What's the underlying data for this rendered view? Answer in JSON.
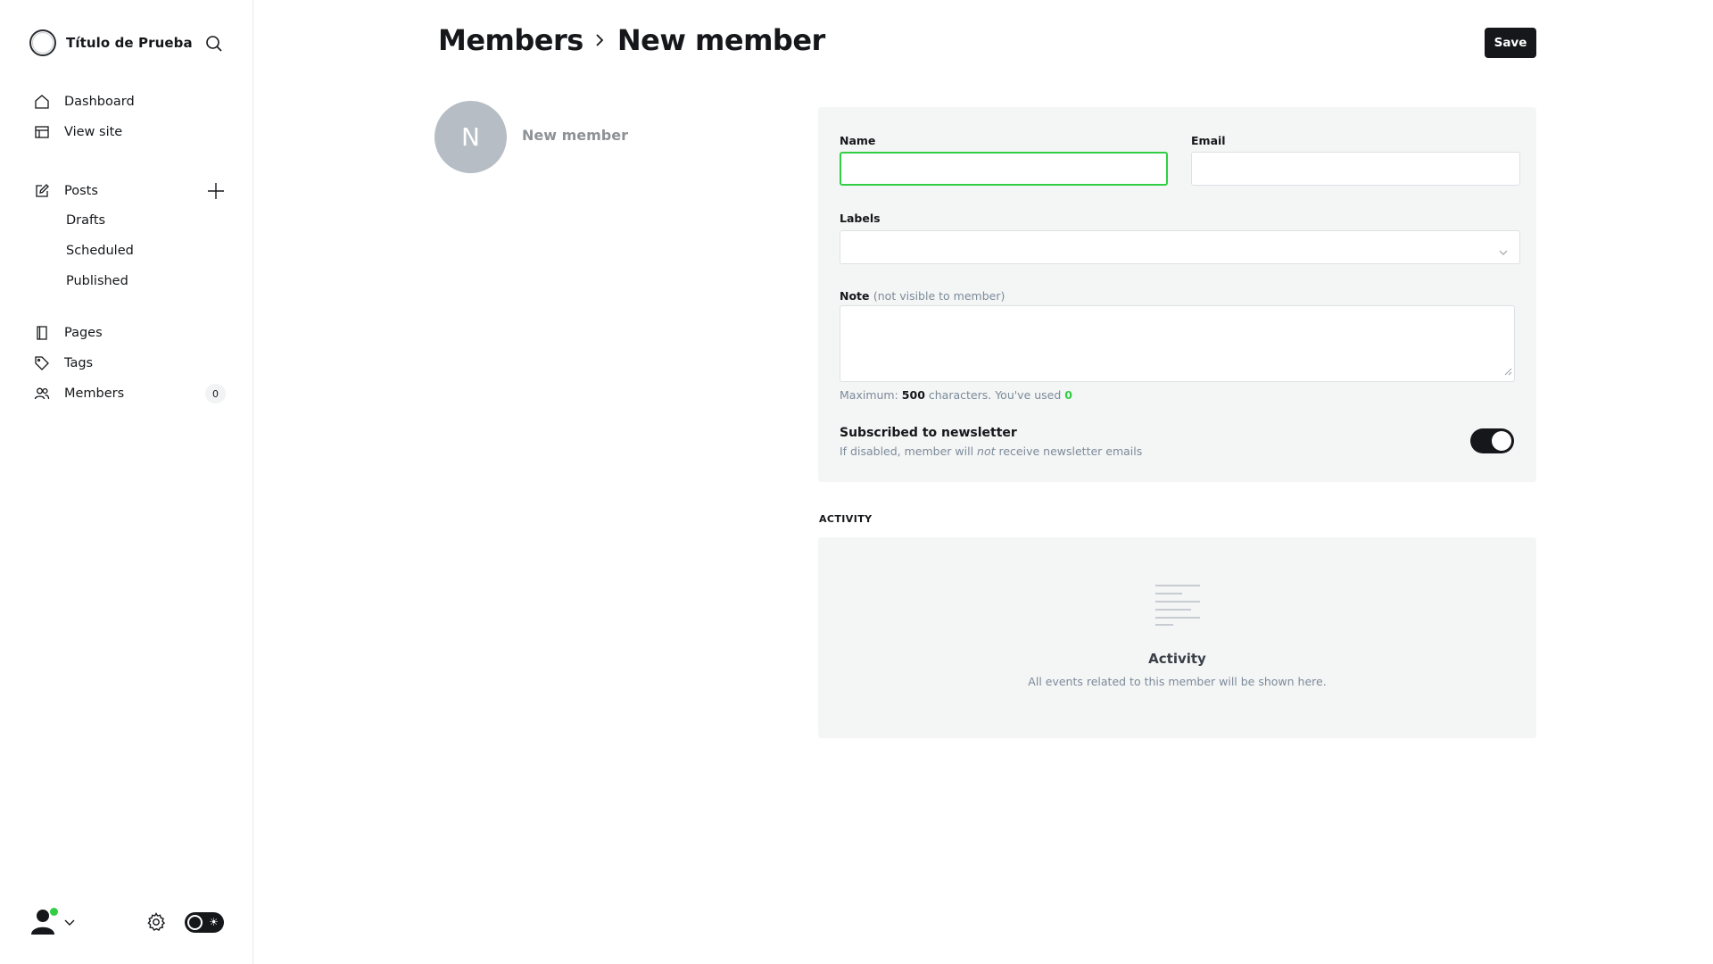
{
  "sidebar": {
    "site_title": "Título de Prueba",
    "nav": {
      "dashboard": "Dashboard",
      "view_site": "View site",
      "posts": "Posts",
      "drafts": "Drafts",
      "scheduled": "Scheduled",
      "published": "Published",
      "pages": "Pages",
      "tags": "Tags",
      "members": "Members",
      "members_count": "0"
    },
    "icons": [
      "site-logo",
      "search-icon",
      "home-icon",
      "layout-icon",
      "edit-icon",
      "plus-icon",
      "book-icon",
      "tag-icon",
      "users-icon",
      "user-icon",
      "chevron-down-icon",
      "gear-icon",
      "theme-toggle-icon"
    ]
  },
  "header": {
    "breadcrumb_parent": "Members",
    "breadcrumb_current": "New member",
    "save_label": "Save"
  },
  "member": {
    "initial": "N",
    "name": "New member"
  },
  "form": {
    "name_label": "Name",
    "name_value": "",
    "email_label": "Email",
    "email_value": "",
    "labels_label": "Labels",
    "note_label": "Note",
    "note_muted": "(not visible to member)",
    "note_value": "",
    "hint_prefix": "Maximum:",
    "hint_max": "500",
    "hint_middle": "characters. You've used",
    "hint_used": "0",
    "newsletter_title": "Subscribed to newsletter",
    "newsletter_desc_1": "If disabled, member will",
    "newsletter_desc_em": "not",
    "newsletter_desc_2": "receive newsletter emails",
    "newsletter_enabled": true
  },
  "activity": {
    "heading": "ACTIVITY",
    "title": "Activity",
    "description": "All events related to this member will be shown here."
  },
  "colors": {
    "accent_green": "#30cf43",
    "dark": "#15171a",
    "card_bg": "#f4f5f5",
    "avatar_bg": "#b6bdc4"
  }
}
